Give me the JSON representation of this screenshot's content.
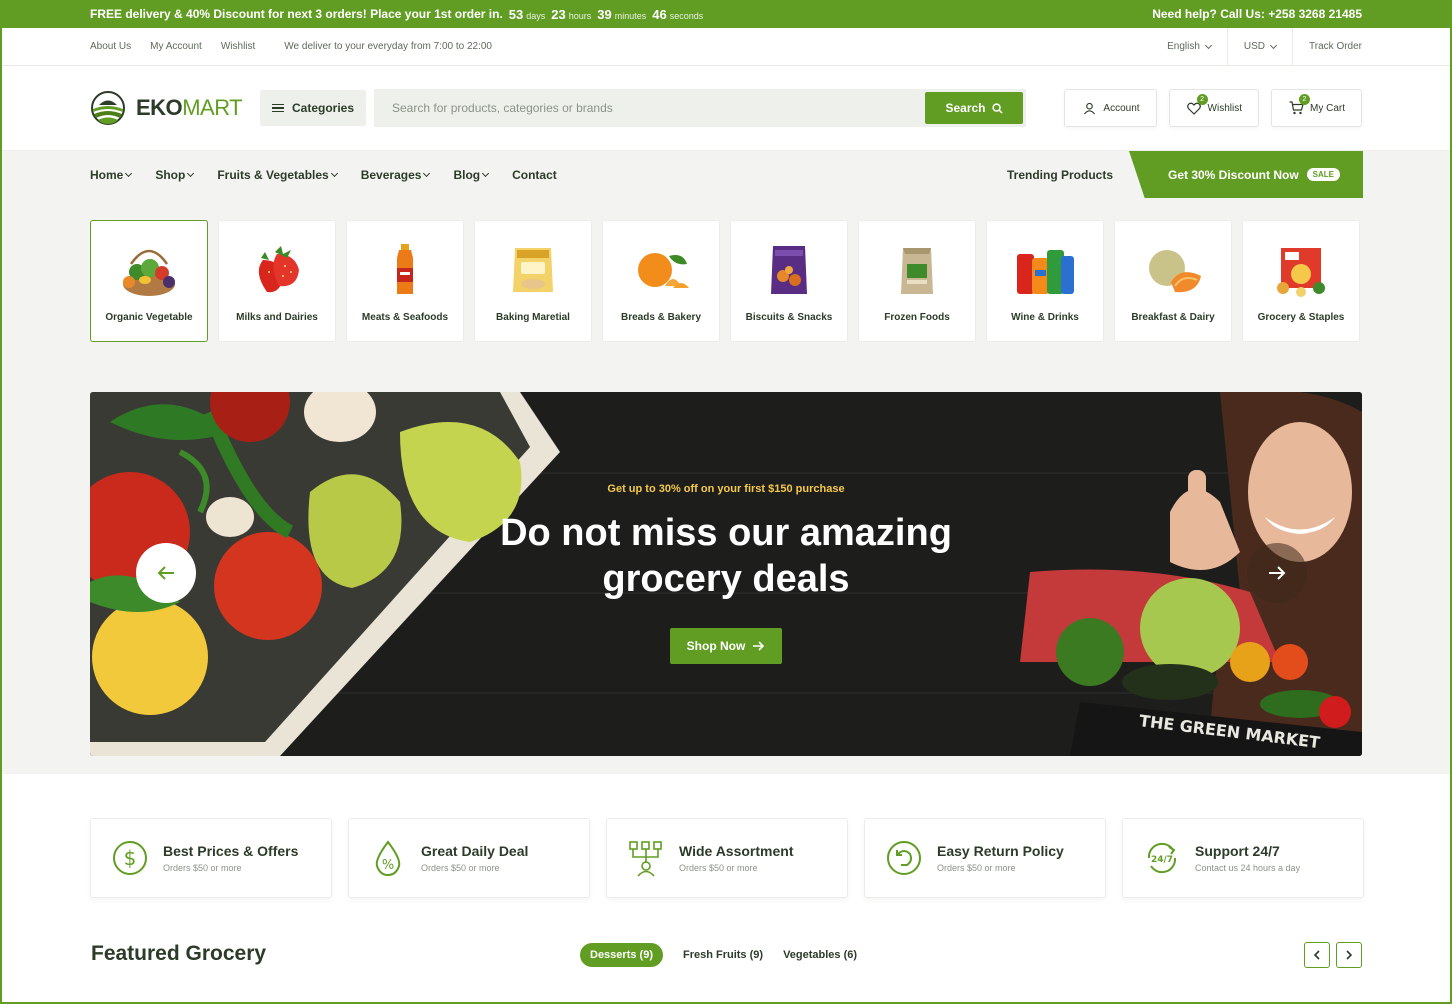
{
  "promo": {
    "text": "FREE delivery & 40% Discount for next 3 orders! Place your 1st order in.",
    "countdown": [
      {
        "value": "53",
        "unit": "days"
      },
      {
        "value": "23",
        "unit": "hours"
      },
      {
        "value": "39",
        "unit": "minutes"
      },
      {
        "value": "46",
        "unit": "seconds"
      }
    ],
    "help": "Need help? Call Us: +258 3268 21485"
  },
  "util": {
    "links": [
      "About Us",
      "My Account",
      "Wishlist"
    ],
    "deliver": "We deliver to your everyday from 7:00 to 22:00",
    "language": "English",
    "currency": "USD",
    "track": "Track Order"
  },
  "header": {
    "logo_bold": "EKO",
    "logo_light": "MART",
    "categories_label": "Categories",
    "search_placeholder": "Search for products, categories or brands",
    "search_label": "Search",
    "account_label": "Account",
    "wishlist_label": "Wishlist",
    "wishlist_count": "2",
    "cart_label": "My Cart",
    "cart_count": "2"
  },
  "nav": {
    "items": [
      "Home",
      "Shop",
      "Fruits & Vegetables",
      "Beverages",
      "Blog",
      "Contact"
    ],
    "trending": "Trending Products",
    "discount": "Get 30% Discount Now",
    "sale": "SALE"
  },
  "categories": [
    {
      "label": "Organic Vegetable",
      "icon": "vegetable-basket-icon"
    },
    {
      "label": "Milks and Dairies",
      "icon": "strawberry-icon"
    },
    {
      "label": "Meats & Seafoods",
      "icon": "juice-bottle-icon"
    },
    {
      "label": "Baking Maretial",
      "icon": "flour-bag-icon"
    },
    {
      "label": "Breads & Bakery",
      "icon": "orange-icon"
    },
    {
      "label": "Biscuits & Snacks",
      "icon": "snack-bag-icon"
    },
    {
      "label": "Frozen Foods",
      "icon": "paper-bag-icon"
    },
    {
      "label": "Wine & Drinks",
      "icon": "soda-cans-icon"
    },
    {
      "label": "Breakfast & Dairy",
      "icon": "melon-icon"
    },
    {
      "label": "Grocery & Staples",
      "icon": "grocery-pack-icon"
    }
  ],
  "hero": {
    "subtitle": "Get up to 30% off on your first $150 purchase",
    "title_line1": "Do not miss our amazing",
    "title_line2": "grocery deals",
    "cta": "Shop Now",
    "crate_text": "THE GREEN MARKET"
  },
  "features": [
    {
      "title": "Best Prices & Offers",
      "sub": "Orders $50 or more",
      "icon": "dollar-icon"
    },
    {
      "title": "Great Daily Deal",
      "sub": "Orders $50 or more",
      "icon": "percent-drop-icon"
    },
    {
      "title": "Wide Assortment",
      "sub": "Orders $50 or more",
      "icon": "assortment-icon"
    },
    {
      "title": "Easy Return Policy",
      "sub": "Orders $50 or more",
      "icon": "return-icon"
    },
    {
      "title": "Support 24/7",
      "sub": "Contact us 24 hours a day",
      "icon": "support-24-icon"
    }
  ],
  "featured": {
    "title": "Featured Grocery",
    "tabs": [
      "Desserts (9)",
      "Fresh Fruits (9)",
      "Vegetables (6)"
    ]
  },
  "colors": {
    "brand": "#629d23",
    "text": "#2c3c28",
    "accent": "#f5c94a"
  }
}
